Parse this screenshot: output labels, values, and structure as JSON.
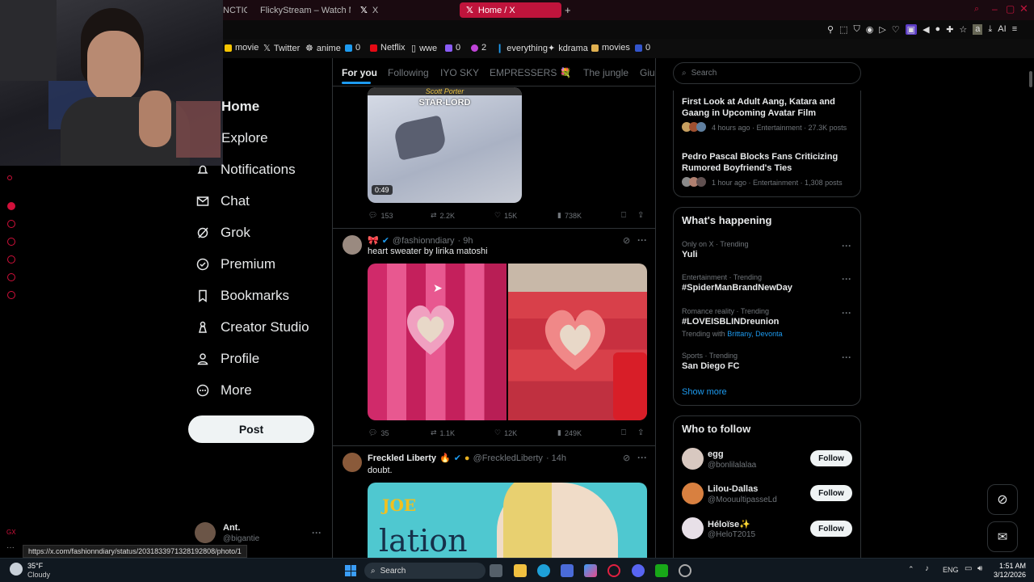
{
  "browser": {
    "tabs": [
      {
        "label": "NCTIO"
      },
      {
        "label": "FlickyStream – Watch Mov"
      },
      {
        "label": "X"
      },
      {
        "label": "Home / X"
      }
    ],
    "bookmarks": [
      {
        "label": "movie"
      },
      {
        "label": "Twitter"
      },
      {
        "label": "anime"
      },
      {
        "label": "0"
      },
      {
        "label": "Netflix"
      },
      {
        "label": "wwe"
      },
      {
        "label": "0"
      },
      {
        "label": "2"
      },
      {
        "label": "everything"
      },
      {
        "label": "kdrama"
      },
      {
        "label": "movies"
      },
      {
        "label": "0"
      }
    ],
    "toolbar_ai": "AI",
    "status_url": "https://x.com/fashionndiary/status/2031833971328192808/photo/1"
  },
  "nav": {
    "items": [
      {
        "label": "Home",
        "icon": "home-icon"
      },
      {
        "label": "Explore",
        "icon": "search-icon"
      },
      {
        "label": "Notifications",
        "icon": "bell-icon"
      },
      {
        "label": "Chat",
        "icon": "mail-icon"
      },
      {
        "label": "Grok",
        "icon": "grok-icon"
      },
      {
        "label": "Premium",
        "icon": "premium-icon"
      },
      {
        "label": "Bookmarks",
        "icon": "bookmark-icon"
      },
      {
        "label": "Creator Studio",
        "icon": "creator-icon"
      },
      {
        "label": "Profile",
        "icon": "person-icon"
      },
      {
        "label": "More",
        "icon": "more-icon"
      }
    ],
    "post_label": "Post",
    "account": {
      "name": "Ant.",
      "handle": "@bigantie"
    }
  },
  "feed": {
    "tabs": [
      "For you",
      "Following",
      "IYO SKY",
      "EMPRESSERS",
      "The jungle",
      "Giul"
    ],
    "tweet1": {
      "video_caption_small": "Scott Porter",
      "video_caption": "STAR-LORD",
      "duration": "0:49",
      "replies": "153",
      "reposts": "2.2K",
      "likes": "15K",
      "views": "738K"
    },
    "tweet2": {
      "handle": "@fashionndiary",
      "time": "· 9h",
      "text": "heart sweater by lirika matoshi",
      "replies": "35",
      "reposts": "1.1K",
      "likes": "12K",
      "views": "249K"
    },
    "tweet3": {
      "name": "Freckled Liberty",
      "handle": "@FreckledLiberty",
      "time": "· 14h",
      "text": "doubt.",
      "image_text_top": "JOE",
      "image_text_bottom": "lation"
    }
  },
  "right": {
    "search_placeholder": "Search",
    "news": [
      {
        "title": "First Look at Adult Aang, Katara and Gaang in Upcoming Avatar Film",
        "meta": "4 hours ago · Entertainment · 27.3K posts"
      },
      {
        "title": "Pedro Pascal Blocks Fans Criticizing Rumored Boyfriend's Ties",
        "meta": "1 hour ago · Entertainment · 1,308 posts"
      }
    ],
    "happening_title": "What's happening",
    "trends": [
      {
        "category": "Only on X · Trending",
        "name": "Yuli",
        "extra_label": "",
        "extra_links": ""
      },
      {
        "category": "Entertainment · Trending",
        "name": "#SpiderManBrandNewDay",
        "extra_label": "",
        "extra_links": ""
      },
      {
        "category": "Romance reality · Trending",
        "name": "#LOVEISBLINDreunion",
        "extra_label": "Trending with",
        "extra_links": "Brittany, Devonta"
      },
      {
        "category": "Sports · Trending",
        "name": "San Diego FC",
        "extra_label": "",
        "extra_links": ""
      }
    ],
    "show_more": "Show more",
    "who_title": "Who to follow",
    "follow": [
      {
        "name": "egg",
        "handle": "@bonlilalalaa",
        "button": "Follow"
      },
      {
        "name": "Lilou-Dallas",
        "handle": "@MoouultipasseLd",
        "button": "Follow"
      },
      {
        "name": "Héloïse✨",
        "handle": "@HeloT2015",
        "button": "Follow"
      }
    ]
  },
  "taskbar": {
    "weather_temp": "35°F",
    "weather_desc": "Cloudy",
    "search_label": "Search",
    "lang": "ENG",
    "time": "1:51 AM",
    "date": "3/12/2026"
  },
  "colors": {
    "accent": "#1d9bf0",
    "brand_tab": "#c0143c",
    "background": "#000000"
  }
}
